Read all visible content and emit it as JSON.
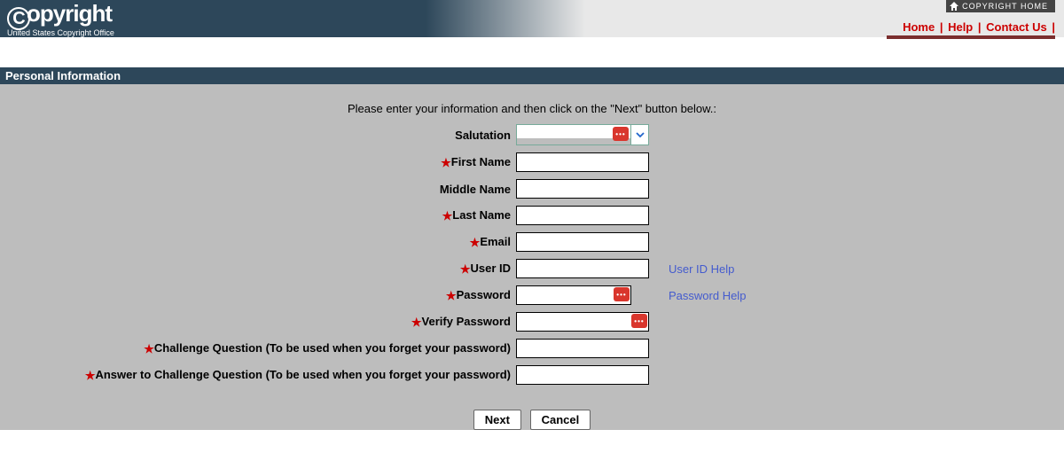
{
  "header": {
    "logo_text": "opyright",
    "logo_subtitle": "United States Copyright Office",
    "top_button": "COPYRIGHT HOME",
    "links": {
      "home": "Home",
      "help": "Help",
      "contact": "Contact Us"
    }
  },
  "section_title": "Personal Information",
  "instruction": "Please enter your information and then click on the \"Next\" button below.:",
  "fields": {
    "salutation": {
      "label": "Salutation",
      "value": ""
    },
    "first_name": {
      "label": "First Name",
      "value": ""
    },
    "middle_name": {
      "label": "Middle Name",
      "value": ""
    },
    "last_name": {
      "label": "Last Name",
      "value": ""
    },
    "email": {
      "label": "Email",
      "value": ""
    },
    "user_id": {
      "label": "User ID",
      "value": "",
      "help": "User ID Help"
    },
    "password": {
      "label": "Password",
      "value": "",
      "help": "Password Help"
    },
    "verify_password": {
      "label": "Verify Password",
      "value": ""
    },
    "challenge_q": {
      "label": "Challenge Question (To be used when you forget your password)",
      "value": ""
    },
    "challenge_a": {
      "label": "Answer to Challenge Question (To be used when you forget your password)",
      "value": ""
    }
  },
  "buttons": {
    "next": "Next",
    "cancel": "Cancel"
  }
}
